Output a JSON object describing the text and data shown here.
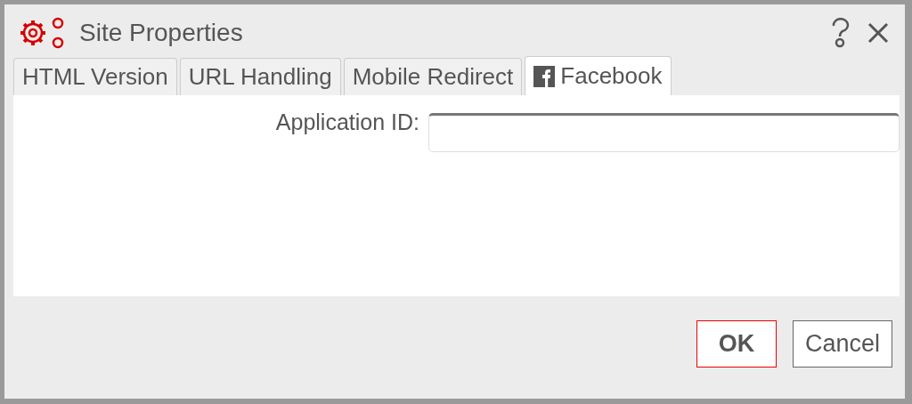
{
  "dialog": {
    "title": "Site Properties"
  },
  "tabs": [
    {
      "label": "HTML Version",
      "selected": false,
      "kind": "text"
    },
    {
      "label": "URL Handling",
      "selected": false,
      "kind": "text"
    },
    {
      "label": "Mobile Redirect",
      "selected": false,
      "kind": "text"
    },
    {
      "label": "Facebook",
      "selected": true,
      "kind": "facebook"
    }
  ],
  "form": {
    "label": "Application ID:"
  },
  "buttons": [
    {
      "label": "OK",
      "kind": "primary"
    },
    {
      "label": "Cancel",
      "kind": "default"
    }
  ]
}
